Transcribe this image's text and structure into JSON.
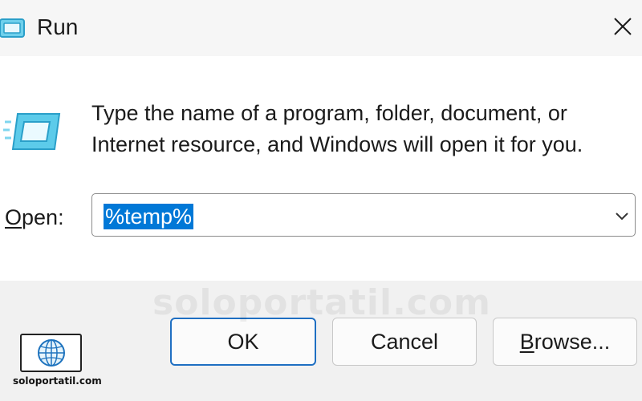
{
  "window": {
    "title": "Run",
    "icon": "run-icon",
    "close_icon": "close-icon"
  },
  "dialog": {
    "description_line1": "Type the name of a program, folder, document, or",
    "description_line2": "Internet resource, and Windows will open it for you.",
    "open_label_mnemonic": "O",
    "open_label_rest": "pen:",
    "open_value": "%temp%",
    "open_value_selected": true
  },
  "buttons": {
    "ok": "OK",
    "cancel": "Cancel",
    "browse_mnemonic": "B",
    "browse_rest": "rowse..."
  },
  "watermark": {
    "text": "soloportatil.com",
    "logo_text": "soloportatil.com",
    "logo_icon": "globe-icon"
  },
  "colors": {
    "selection": "#0078d7",
    "ok_border": "#1f6fc2",
    "icon_cyan": "#4fc3e6"
  }
}
